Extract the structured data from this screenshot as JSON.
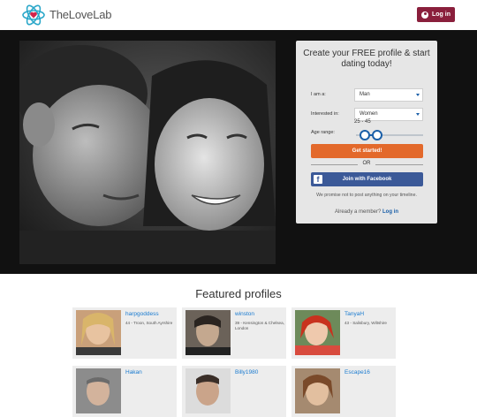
{
  "header": {
    "brand": "TheLoveLab",
    "login_label": "Log in"
  },
  "signup": {
    "title": "Create your FREE profile & start dating today!",
    "i_am_label": "I am a:",
    "i_am_value": "Man",
    "interested_label": "Interested in:",
    "interested_value": "Women",
    "age_label": "Age range:",
    "age_value": "25 - 45",
    "age_min": 25,
    "age_max": 45,
    "start_label": "Get started!",
    "or_label": "OR",
    "facebook_label": "Join with Facebook",
    "promise": "We promise not to post anything on your timeline.",
    "member_text": "Already a member?",
    "member_link": "Log in"
  },
  "featured": {
    "title": "Featured profiles",
    "profiles": [
      {
        "name": "harpgoddess",
        "location": "44 - Troon, South Ayrshire"
      },
      {
        "name": "winston",
        "location": "39 - Kensington & Chelsea, London"
      },
      {
        "name": "TanyaH",
        "location": "43 - Salisbury, Wiltshire"
      },
      {
        "name": "Hakan",
        "location": ""
      },
      {
        "name": "Billy1980",
        "location": ""
      },
      {
        "name": "Escape16",
        "location": ""
      }
    ]
  },
  "colors": {
    "brand": "#8a1f3c",
    "accent": "#e3692b",
    "facebook": "#3b5998",
    "link": "#1a7bd0"
  }
}
